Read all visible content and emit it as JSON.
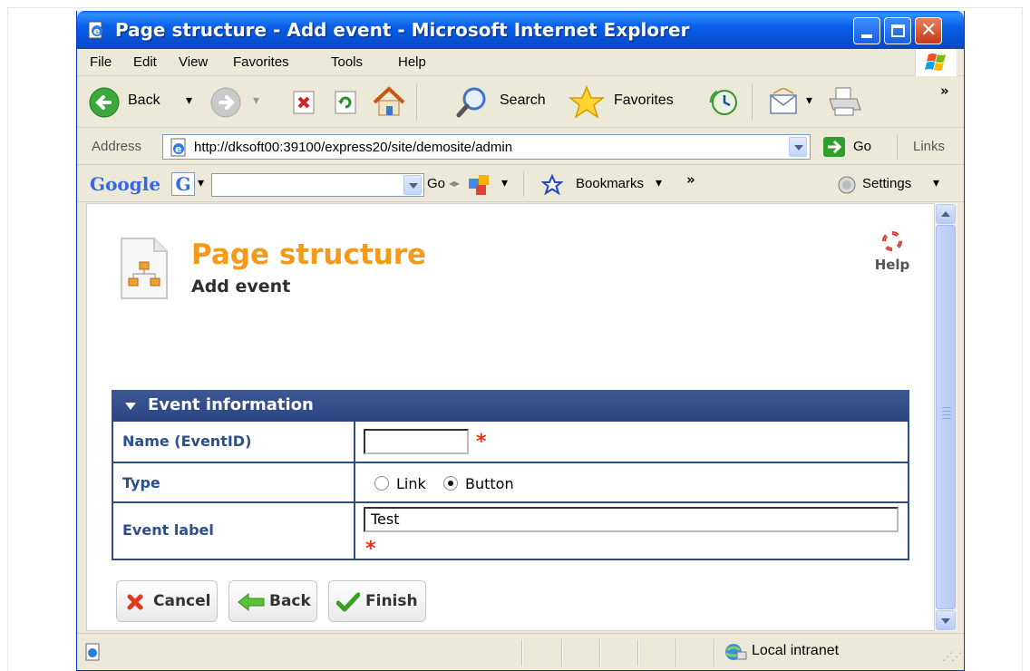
{
  "window": {
    "title": "Page structure - Add event - Microsoft Internet Explorer"
  },
  "menu": {
    "items": [
      "File",
      "Edit",
      "View",
      "Favorites",
      "Tools",
      "Help"
    ]
  },
  "toolbar": {
    "back_label": "Back",
    "search_label": "Search",
    "favorites_label": "Favorites",
    "more": "»"
  },
  "address": {
    "label": "Address",
    "url": "http://dksoft00:39100/express20/site/demosite/admin",
    "go_label": "Go",
    "links_label": "Links"
  },
  "google": {
    "logo": "Google",
    "go_label": "Go",
    "bookmarks_label": "Bookmarks",
    "more": "»",
    "settings_label": "Settings"
  },
  "page": {
    "title": "Page structure",
    "subtitle": "Add event",
    "help_label": "Help"
  },
  "form": {
    "section_title": "Event information",
    "name_label": "Name (EventID)",
    "name_value": "",
    "required_marker": "*",
    "type_label": "Type",
    "type_options": [
      "Link",
      "Button"
    ],
    "type_selected": "Button",
    "event_label_label": "Event label",
    "event_label_value": "Test"
  },
  "buttons": {
    "cancel": "Cancel",
    "back": "Back",
    "finish": "Finish"
  },
  "status": {
    "zone": "Local intranet"
  },
  "colors": {
    "title_orange": "#f39a1a",
    "section_blue": "#2f4c8a",
    "label_blue": "#2c4f8c",
    "required_red": "#e8311a"
  }
}
